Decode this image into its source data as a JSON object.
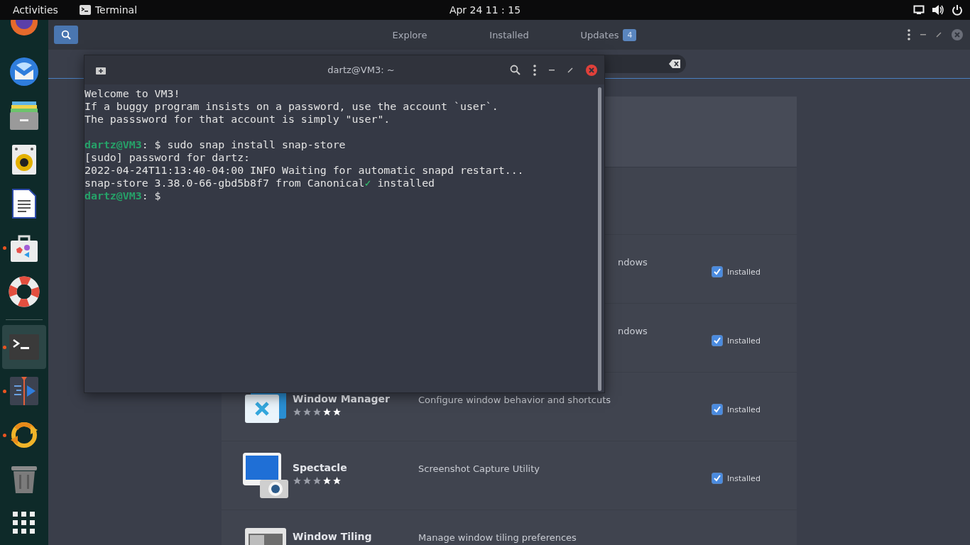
{
  "top_bar": {
    "activities": "Activities",
    "app_menu": "Terminal",
    "clock": "Apr 24  11 : 15"
  },
  "dock": {
    "pinned": [
      {
        "kind": "browser",
        "running": false,
        "selected": false
      },
      {
        "kind": "mail",
        "running": false,
        "selected": false
      },
      {
        "kind": "files",
        "running": false,
        "selected": false
      },
      {
        "kind": "music",
        "running": false,
        "selected": false
      },
      {
        "kind": "writer",
        "running": false,
        "selected": false
      },
      {
        "kind": "store",
        "running": true,
        "selected": false
      },
      {
        "kind": "help",
        "running": false,
        "selected": false
      }
    ],
    "open": [
      {
        "kind": "terminal",
        "running": true,
        "selected": true
      },
      {
        "kind": "editor",
        "running": true,
        "selected": false
      },
      {
        "kind": "sync",
        "running": true,
        "selected": false
      },
      {
        "kind": "trash",
        "running": false,
        "selected": false
      }
    ]
  },
  "software": {
    "search_toggle": {
      "selected": true
    },
    "tabs": [
      {
        "label": "Explore",
        "selected": false
      },
      {
        "label": "Installed",
        "selected": false
      },
      {
        "label": "Updates",
        "selected": false,
        "badge": "4"
      }
    ],
    "rows": [
      {
        "kind": "covered",
        "description": "ndows",
        "status": "Installed",
        "checked": true
      },
      {
        "kind": "covered",
        "description": "ndows",
        "status": "Installed",
        "checked": true
      },
      {
        "kind": "app",
        "name": "Window Manager",
        "stars": 2,
        "description": "Configure window behavior and shortcuts",
        "status": "Installed",
        "checked": true
      },
      {
        "kind": "app",
        "name": "Spectacle",
        "stars": 2,
        "description": "Screenshot Capture Utility",
        "status": "Installed",
        "checked": true
      },
      {
        "kind": "app",
        "name": "Window Tiling",
        "description": "Manage window tiling preferences"
      }
    ]
  },
  "terminal": {
    "title": "dartz@VM3: ~",
    "blocks": [
      [
        [
          {
            "kind": "plain",
            "text": "Welcome to VM3!"
          }
        ],
        [
          {
            "kind": "plain",
            "text": "If a buggy program insists on a password, use the account `user`."
          }
        ],
        [
          {
            "kind": "plain",
            "text": "The passsword for that account is simply \"user\"."
          }
        ]
      ],
      [
        [
          {
            "kind": "prompt",
            "text": "dartz@VM3"
          },
          {
            "kind": "plain",
            "text": ": $ sudo snap install snap-store"
          }
        ],
        [
          {
            "kind": "plain",
            "text": "[sudo] password for dartz:"
          }
        ],
        [
          {
            "kind": "plain",
            "text": "2022-04-24T11:13:40-04:00 INFO Waiting for automatic snapd restart..."
          }
        ],
        [
          {
            "kind": "plain",
            "text": "snap-store 3.38.0-66-gbd5b8f7 from Canonical"
          },
          {
            "kind": "check",
            "text": "✓"
          },
          {
            "kind": "plain",
            "text": " installed"
          }
        ],
        [
          {
            "kind": "prompt",
            "text": "dartz@VM3"
          },
          {
            "kind": "plain",
            "text": ": $"
          }
        ]
      ]
    ]
  }
}
